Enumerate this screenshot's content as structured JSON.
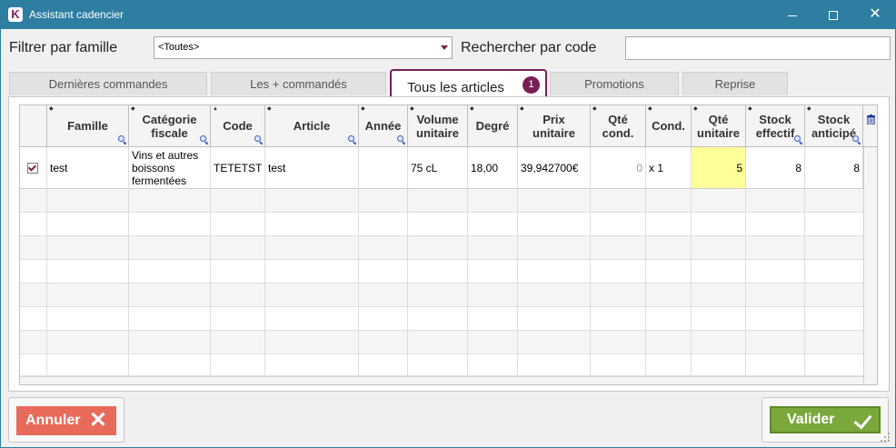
{
  "window": {
    "title": "Assistant cadencier",
    "icon_letter": "K",
    "minimize": "—",
    "close": "✕"
  },
  "filters": {
    "family_label": "Filtrer par famille",
    "family_value": "<Toutes>",
    "search_label": "Rechercher par code",
    "search_value": ""
  },
  "tabs": [
    {
      "label": "Dernières commandes",
      "active": false
    },
    {
      "label": "Les + commandés",
      "active": false
    },
    {
      "label": "Tous les articles",
      "active": true,
      "badge": "1"
    },
    {
      "label": "Promotions",
      "active": false
    },
    {
      "label": "Reprise",
      "active": false
    }
  ],
  "table": {
    "headers": {
      "famille": "Famille",
      "categorie": "Catégorie fiscale",
      "code": "Code",
      "article": "Article",
      "annee": "Année",
      "volume": "Volume unitaire",
      "degre": "Degré",
      "prix": "Prix unitaire",
      "qte_cond": "Qté cond.",
      "cond": "Cond.",
      "qte_unit": "Qté unitaire",
      "stock_eff": "Stock effectif",
      "stock_ant": "Stock anticipé"
    },
    "rows": [
      {
        "checked": true,
        "famille": "test",
        "categorie": "Vins et autres boissons fermentées",
        "code": "TETETST",
        "article": "test",
        "annee": "",
        "volume": "75 cL",
        "degre": "18,00",
        "prix": "39,942700€",
        "qte_cond": "0",
        "cond": "x 1",
        "qte_unit": "5",
        "stock_eff": "8",
        "stock_ant": "8"
      }
    ]
  },
  "buttons": {
    "cancel": "Annuler",
    "validate": "Valider"
  },
  "colors": {
    "titlebar": "#2d7ea1",
    "accent": "#7a1f55",
    "cancel": "#e86a5a",
    "validate": "#7aa83c",
    "highlight": "#ffff99"
  }
}
